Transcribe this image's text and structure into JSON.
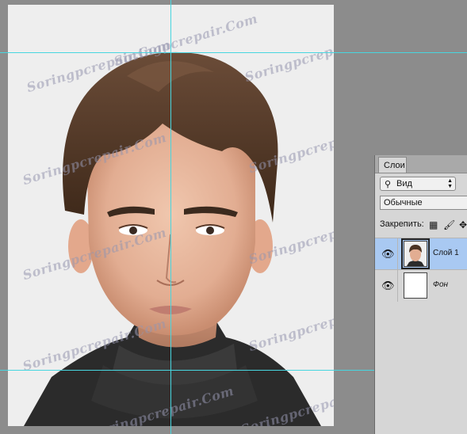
{
  "canvas": {
    "watermark_text": "Soringpcrepair.Com"
  },
  "layers_panel": {
    "tab_label": "Слои",
    "filter": {
      "value": "Вид",
      "icon": "search-icon"
    },
    "blend_mode": "Обычные",
    "lock_label": "Закрепить:",
    "layers": [
      {
        "name": "Слой 1",
        "selected": true
      },
      {
        "name": "Фон",
        "selected": false
      }
    ]
  },
  "colors": {
    "guide": "#47d6e0",
    "workspace": "#8c8c8c",
    "panel_bg": "#d6d6d6",
    "selected_layer": "#a9c9f2"
  }
}
